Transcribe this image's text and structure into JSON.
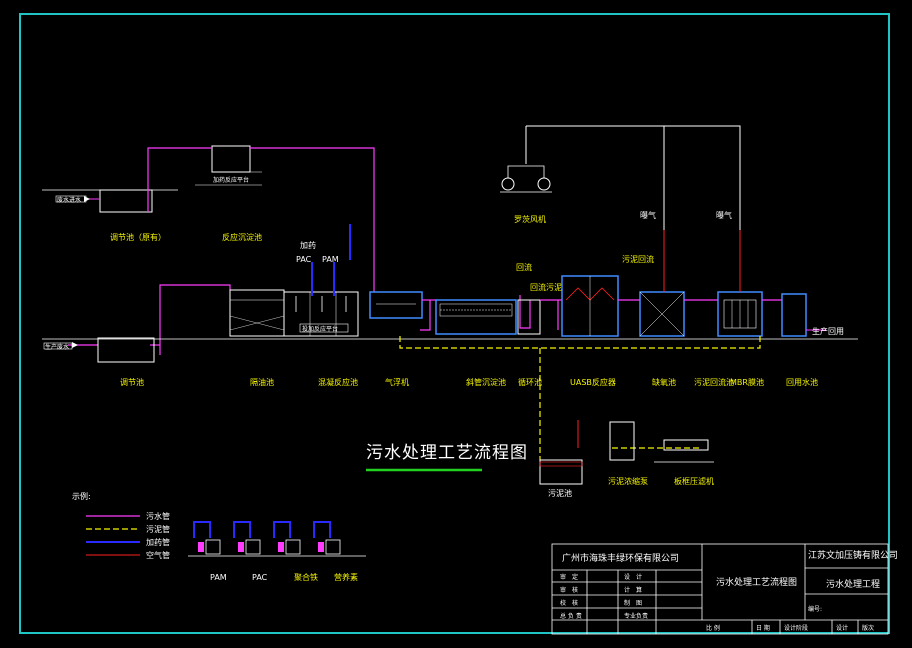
{
  "drawing_title": "污水处理工艺流程图",
  "colors": {
    "frame": "#1fc4c4",
    "sewage_pipe": "#ff3cff",
    "sludge_pipe": "#f5f500",
    "dosing_pipe": "#2a2aff",
    "air_pipe": "#ff2020",
    "equipment": "#ffffff",
    "tank_blue": "#3f8cff",
    "title_underline": "#22d022"
  },
  "units": {
    "regulating_tank_top": "调节池（原有）",
    "reaction_tank_top": "反应沉淀池",
    "dosing_platform": "投加反应平台",
    "canopy_note": "加药反应平台",
    "pac": "PAC",
    "pam": "PAM",
    "dosing": "加药",
    "blower": "罗茨风机",
    "aeration_1": "曝气",
    "aeration_2": "曝气",
    "sludge_return": "污泥回流",
    "reflux": "回流",
    "backflow_sludge": "回流污泥",
    "regulating_pool": "调节池",
    "oil_separator": "隔油池",
    "coag_tank": "混凝反应池",
    "air_flotation": "气浮机",
    "sedimentation": "斜管沉淀池",
    "circulation": "循环池",
    "uasb": "UASB反应器",
    "anoxic": "缺氧池",
    "sludge_reflux_tank": "污泥回流池",
    "mbr": "MBR膜池",
    "reuse_tank": "回用水池",
    "reuse_out": "生产回用",
    "sludge_tank": "污泥池",
    "sludge_pump": "污泥浓缩泵",
    "filter_press": "板框压滤机",
    "inlet_label": "废水进水",
    "inlet_label_2": "生产废水"
  },
  "legend": {
    "heading": "示例:",
    "items": [
      {
        "label": "污水管",
        "color_key": "sewage_pipe"
      },
      {
        "label": "污泥管",
        "color_key": "sludge_pipe"
      },
      {
        "label": "加药管",
        "color_key": "dosing_pipe"
      },
      {
        "label": "空气管",
        "color_key": "air_pipe"
      }
    ],
    "dosing_units": [
      "PAM",
      "PAC",
      "聚合铁",
      "营养素"
    ]
  },
  "title_block": {
    "company": "广州市海珠丰绿环保有限公司",
    "client": "江苏文加压铸有限公司",
    "drawing_name": "污水处理工艺流程图",
    "project": "污水处理工程",
    "rows": [
      [
        "审　定",
        "设　计"
      ],
      [
        "审　核",
        "计　算"
      ],
      [
        "校　核",
        "制　图"
      ],
      [
        "总 负 责",
        "专业负责"
      ]
    ],
    "project_no_label": "编号:",
    "footer": [
      "比 例",
      "日 期",
      "设计阶段",
      "设计",
      "版次"
    ]
  }
}
